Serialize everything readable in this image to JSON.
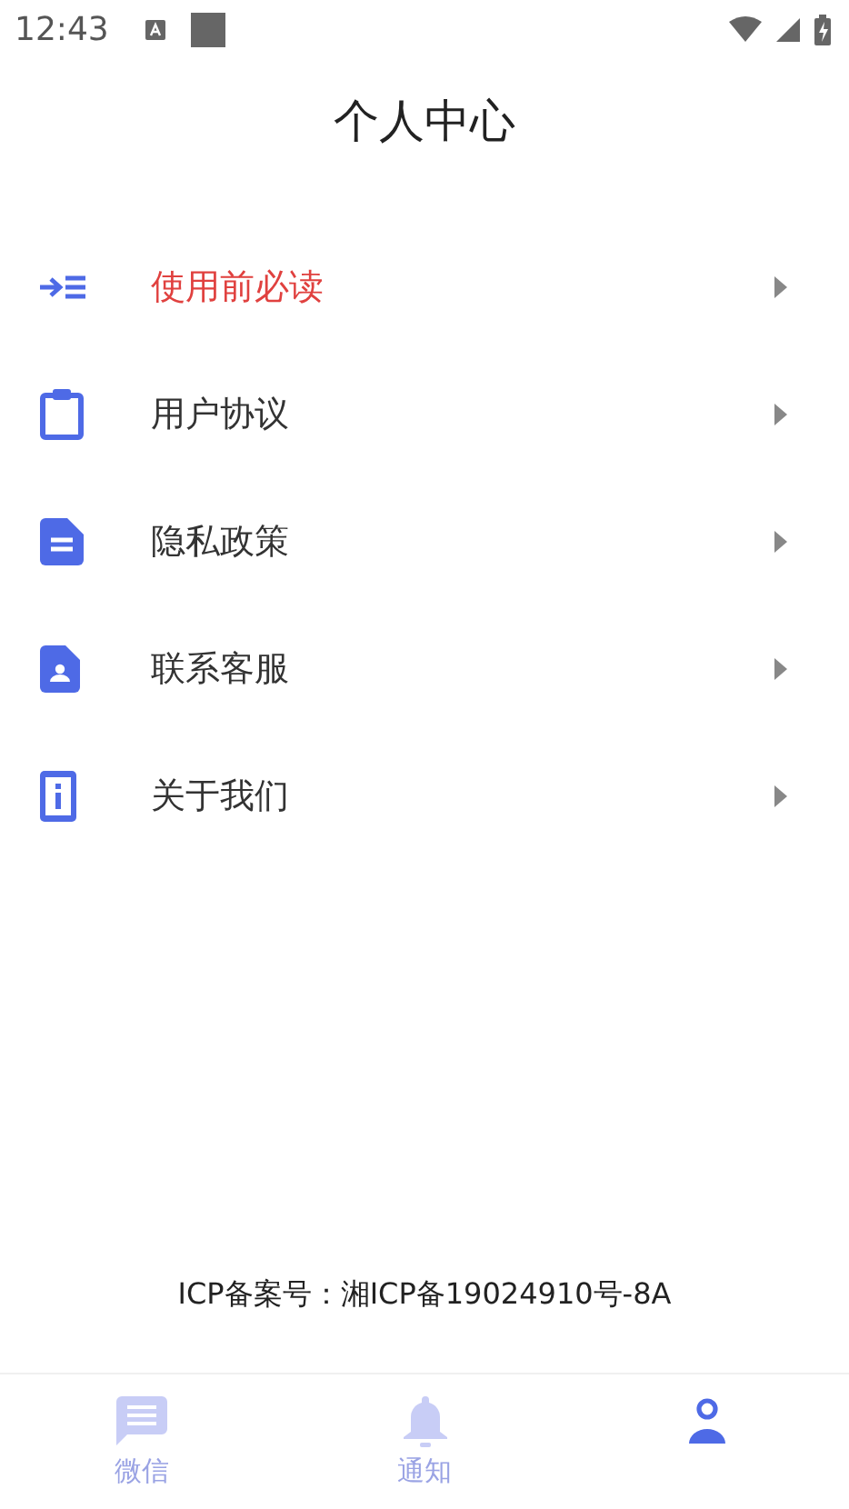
{
  "status_bar": {
    "time": "12:43"
  },
  "title": "个人中心",
  "menu": [
    {
      "kind": "read-first",
      "label": "使用前必读",
      "highlighted": true
    },
    {
      "kind": "clipboard",
      "label": "用户协议",
      "highlighted": false
    },
    {
      "kind": "document",
      "label": "隐私政策",
      "highlighted": false
    },
    {
      "kind": "contact",
      "label": "联系客服",
      "highlighted": false
    },
    {
      "kind": "info",
      "label": "关于我们",
      "highlighted": false
    }
  ],
  "footer": "ICP备案号：湘ICP备19024910号-8A",
  "tabs": [
    {
      "kind": "chat",
      "label": "微信",
      "selected": false
    },
    {
      "kind": "bell",
      "label": "通知",
      "selected": false
    },
    {
      "kind": "person",
      "selected": true
    }
  ]
}
